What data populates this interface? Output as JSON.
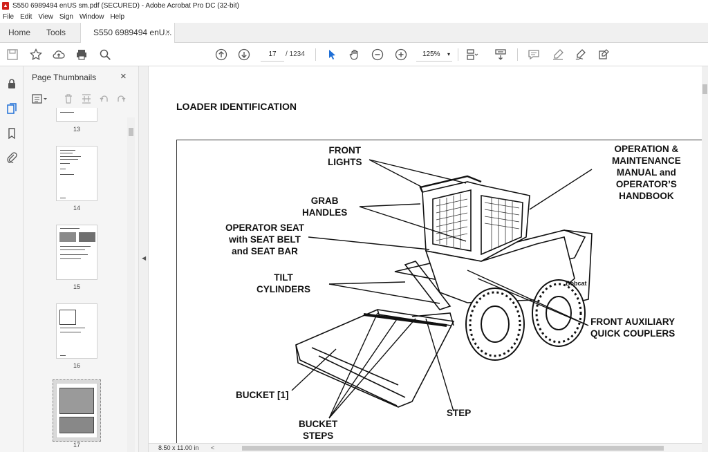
{
  "window": {
    "title": "S550 6989494 enUS sm.pdf (SECURED) - Adobe Acrobat Pro DC (32-bit)",
    "app_icon": "pdf-icon"
  },
  "menu": [
    "File",
    "Edit",
    "View",
    "Sign",
    "Window",
    "Help"
  ],
  "tabs": {
    "home": "Home",
    "tools": "Tools",
    "document": "S550 6989494 enU...",
    "close": "×"
  },
  "toolbar": {
    "page_current": "17",
    "page_total": "/  1234",
    "zoom": "125%",
    "zoom_caret": "▾"
  },
  "panel": {
    "title": "Page Thumbnails",
    "close": "×",
    "thumbnails": [
      {
        "page": "13"
      },
      {
        "page": "14"
      },
      {
        "page": "15"
      },
      {
        "page": "16"
      },
      {
        "page": "17",
        "selected": true
      }
    ]
  },
  "document": {
    "heading": "LOADER IDENTIFICATION",
    "labels": {
      "front_lights": "FRONT\nLIGHTS",
      "grab_handles": "GRAB\nHANDLES",
      "operator_seat": "OPERATOR SEAT\nwith SEAT BELT\nand SEAT BAR",
      "tilt_cylinders": "TILT\nCYLINDERS",
      "bucket": "BUCKET [1]",
      "bucket_steps": "BUCKET\nSTEPS",
      "step": "STEP",
      "manual": "OPERATION &\nMAINTENANCE\nMANUAL and\nOPERATOR’S\nHANDBOOK",
      "couplers": "FRONT AUXILIARY\nQUICK COUPLERS",
      "brand": "Bobcat"
    }
  },
  "status": {
    "page_size": "8.50 x 11.00 in",
    "scroll_left": "<"
  }
}
